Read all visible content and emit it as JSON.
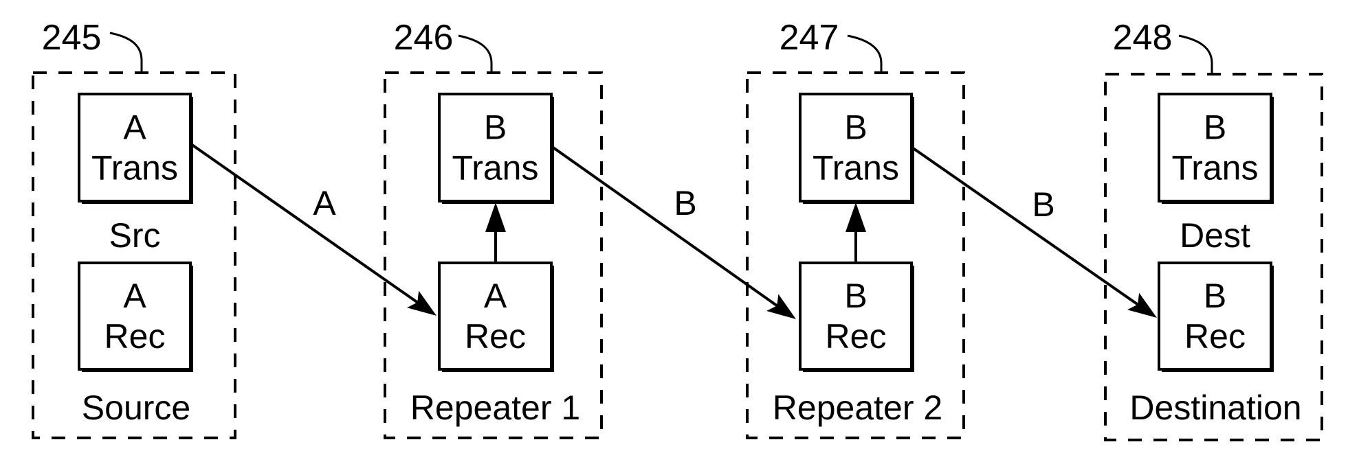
{
  "figure": {
    "colors": {
      "ink": "#000000",
      "background": "#ffffff"
    },
    "nodes": [
      {
        "id": "source",
        "ref_numeral": "245",
        "label": "Source",
        "mid_label": "Src",
        "transmitter": {
          "protocol": "A",
          "role": "Trans"
        },
        "receiver": {
          "protocol": "A",
          "role": "Rec"
        },
        "internal_link": false
      },
      {
        "id": "repeater1",
        "ref_numeral": "246",
        "label": "Repeater 1",
        "mid_label": "",
        "transmitter": {
          "protocol": "B",
          "role": "Trans"
        },
        "receiver": {
          "protocol": "A",
          "role": "Rec"
        },
        "internal_link": true
      },
      {
        "id": "repeater2",
        "ref_numeral": "247",
        "label": "Repeater 2",
        "mid_label": "",
        "transmitter": {
          "protocol": "B",
          "role": "Trans"
        },
        "receiver": {
          "protocol": "B",
          "role": "Rec"
        },
        "internal_link": true
      },
      {
        "id": "destination",
        "ref_numeral": "248",
        "label": "Destination",
        "mid_label": "Dest",
        "transmitter": {
          "protocol": "B",
          "role": "Trans"
        },
        "receiver": {
          "protocol": "B",
          "role": "Rec"
        },
        "internal_link": false
      }
    ],
    "links": [
      {
        "from": "source",
        "to": "repeater1",
        "label": "A"
      },
      {
        "from": "repeater1",
        "to": "repeater2",
        "label": "B"
      },
      {
        "from": "repeater2",
        "to": "destination",
        "label": "B"
      }
    ]
  }
}
